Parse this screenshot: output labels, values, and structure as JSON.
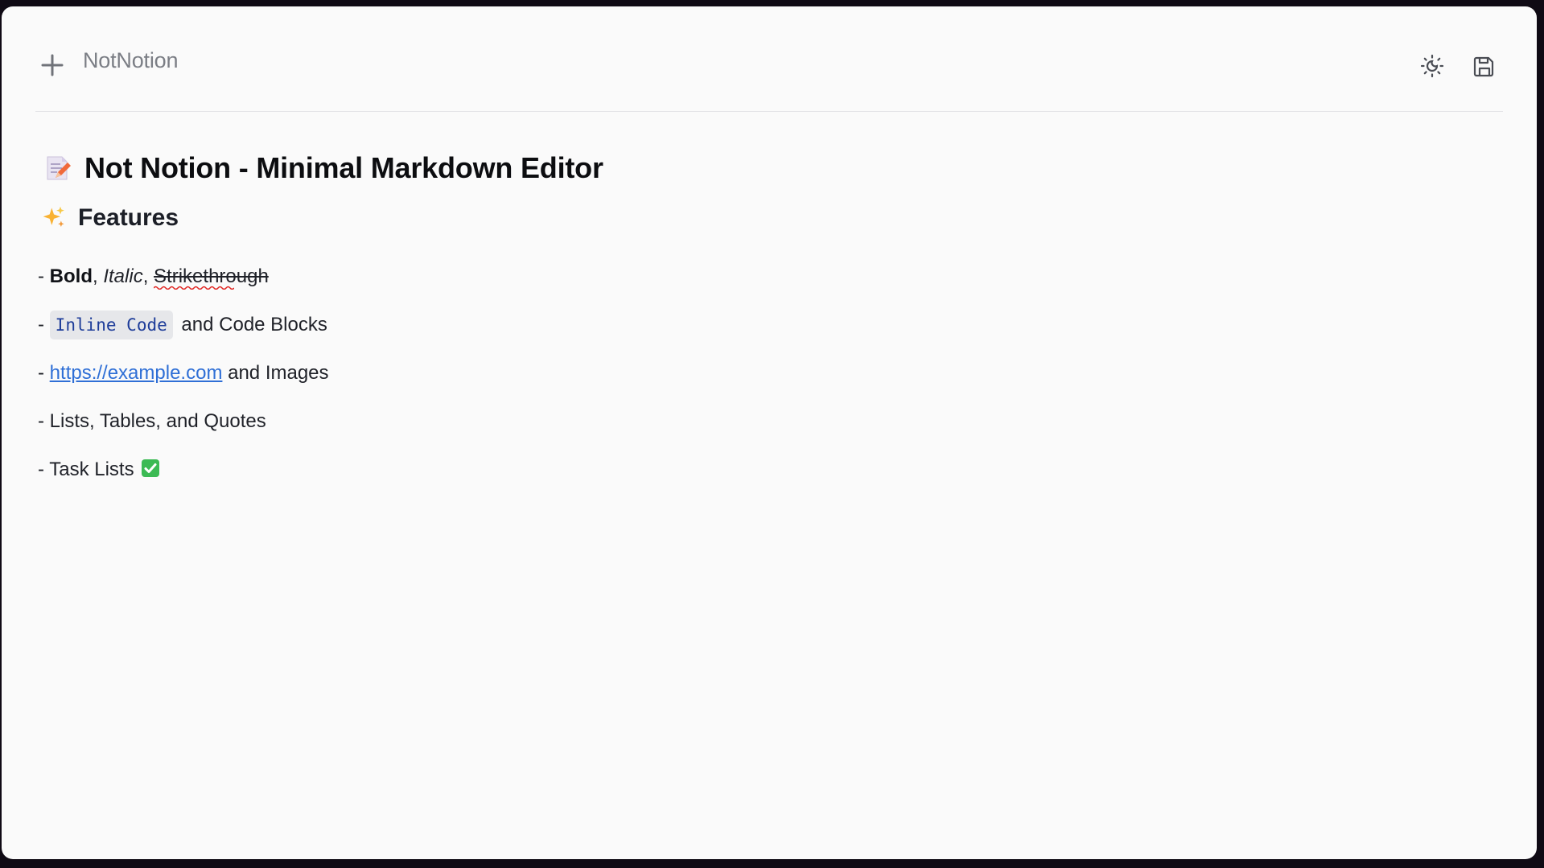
{
  "app": {
    "title": "NotNotion"
  },
  "toolbar": {
    "new_icon": "plus-icon",
    "theme_icon": "sun-moon-icon",
    "save_icon": "save-icon"
  },
  "document": {
    "h1_emoji": "memo-emoji",
    "h1_text": "Not Notion - Minimal Markdown Editor",
    "h2_emoji": "sparkles-emoji",
    "h2_text": "Features",
    "line1": {
      "dash": "- ",
      "bold": "Bold",
      "sep1": ", ",
      "italic": "Italic",
      "sep2": ", ",
      "strike": "Strikethrough"
    },
    "line2": {
      "dash": "- ",
      "code": "Inline Code",
      "rest": "and Code Blocks"
    },
    "line3": {
      "dash": "- ",
      "link": "https://example.com",
      "rest": " and Images"
    },
    "line4": {
      "text": "- Lists, Tables, and Quotes"
    },
    "line5": {
      "text": "- Task Lists",
      "emoji": "check-mark-emoji"
    }
  },
  "colors": {
    "background": "#fafafa",
    "code_text": "#1d3c99",
    "code_bg": "#e6e7ea",
    "link": "#2f6fd6",
    "spellcheck": "#e0211d",
    "check_green": "#3cba54"
  }
}
